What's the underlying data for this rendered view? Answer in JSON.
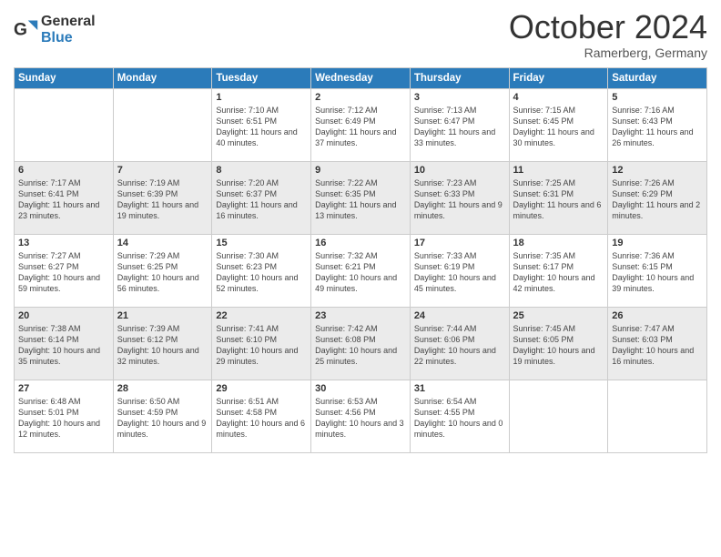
{
  "header": {
    "logo_line1": "General",
    "logo_line2": "Blue",
    "month": "October 2024",
    "location": "Ramerberg, Germany"
  },
  "days_of_week": [
    "Sunday",
    "Monday",
    "Tuesday",
    "Wednesday",
    "Thursday",
    "Friday",
    "Saturday"
  ],
  "rows": [
    [
      {
        "day": "",
        "sunrise": "",
        "sunset": "",
        "daylight": ""
      },
      {
        "day": "",
        "sunrise": "",
        "sunset": "",
        "daylight": ""
      },
      {
        "day": "1",
        "sunrise": "Sunrise: 7:10 AM",
        "sunset": "Sunset: 6:51 PM",
        "daylight": "Daylight: 11 hours and 40 minutes."
      },
      {
        "day": "2",
        "sunrise": "Sunrise: 7:12 AM",
        "sunset": "Sunset: 6:49 PM",
        "daylight": "Daylight: 11 hours and 37 minutes."
      },
      {
        "day": "3",
        "sunrise": "Sunrise: 7:13 AM",
        "sunset": "Sunset: 6:47 PM",
        "daylight": "Daylight: 11 hours and 33 minutes."
      },
      {
        "day": "4",
        "sunrise": "Sunrise: 7:15 AM",
        "sunset": "Sunset: 6:45 PM",
        "daylight": "Daylight: 11 hours and 30 minutes."
      },
      {
        "day": "5",
        "sunrise": "Sunrise: 7:16 AM",
        "sunset": "Sunset: 6:43 PM",
        "daylight": "Daylight: 11 hours and 26 minutes."
      }
    ],
    [
      {
        "day": "6",
        "sunrise": "Sunrise: 7:17 AM",
        "sunset": "Sunset: 6:41 PM",
        "daylight": "Daylight: 11 hours and 23 minutes."
      },
      {
        "day": "7",
        "sunrise": "Sunrise: 7:19 AM",
        "sunset": "Sunset: 6:39 PM",
        "daylight": "Daylight: 11 hours and 19 minutes."
      },
      {
        "day": "8",
        "sunrise": "Sunrise: 7:20 AM",
        "sunset": "Sunset: 6:37 PM",
        "daylight": "Daylight: 11 hours and 16 minutes."
      },
      {
        "day": "9",
        "sunrise": "Sunrise: 7:22 AM",
        "sunset": "Sunset: 6:35 PM",
        "daylight": "Daylight: 11 hours and 13 minutes."
      },
      {
        "day": "10",
        "sunrise": "Sunrise: 7:23 AM",
        "sunset": "Sunset: 6:33 PM",
        "daylight": "Daylight: 11 hours and 9 minutes."
      },
      {
        "day": "11",
        "sunrise": "Sunrise: 7:25 AM",
        "sunset": "Sunset: 6:31 PM",
        "daylight": "Daylight: 11 hours and 6 minutes."
      },
      {
        "day": "12",
        "sunrise": "Sunrise: 7:26 AM",
        "sunset": "Sunset: 6:29 PM",
        "daylight": "Daylight: 11 hours and 2 minutes."
      }
    ],
    [
      {
        "day": "13",
        "sunrise": "Sunrise: 7:27 AM",
        "sunset": "Sunset: 6:27 PM",
        "daylight": "Daylight: 10 hours and 59 minutes."
      },
      {
        "day": "14",
        "sunrise": "Sunrise: 7:29 AM",
        "sunset": "Sunset: 6:25 PM",
        "daylight": "Daylight: 10 hours and 56 minutes."
      },
      {
        "day": "15",
        "sunrise": "Sunrise: 7:30 AM",
        "sunset": "Sunset: 6:23 PM",
        "daylight": "Daylight: 10 hours and 52 minutes."
      },
      {
        "day": "16",
        "sunrise": "Sunrise: 7:32 AM",
        "sunset": "Sunset: 6:21 PM",
        "daylight": "Daylight: 10 hours and 49 minutes."
      },
      {
        "day": "17",
        "sunrise": "Sunrise: 7:33 AM",
        "sunset": "Sunset: 6:19 PM",
        "daylight": "Daylight: 10 hours and 45 minutes."
      },
      {
        "day": "18",
        "sunrise": "Sunrise: 7:35 AM",
        "sunset": "Sunset: 6:17 PM",
        "daylight": "Daylight: 10 hours and 42 minutes."
      },
      {
        "day": "19",
        "sunrise": "Sunrise: 7:36 AM",
        "sunset": "Sunset: 6:15 PM",
        "daylight": "Daylight: 10 hours and 39 minutes."
      }
    ],
    [
      {
        "day": "20",
        "sunrise": "Sunrise: 7:38 AM",
        "sunset": "Sunset: 6:14 PM",
        "daylight": "Daylight: 10 hours and 35 minutes."
      },
      {
        "day": "21",
        "sunrise": "Sunrise: 7:39 AM",
        "sunset": "Sunset: 6:12 PM",
        "daylight": "Daylight: 10 hours and 32 minutes."
      },
      {
        "day": "22",
        "sunrise": "Sunrise: 7:41 AM",
        "sunset": "Sunset: 6:10 PM",
        "daylight": "Daylight: 10 hours and 29 minutes."
      },
      {
        "day": "23",
        "sunrise": "Sunrise: 7:42 AM",
        "sunset": "Sunset: 6:08 PM",
        "daylight": "Daylight: 10 hours and 25 minutes."
      },
      {
        "day": "24",
        "sunrise": "Sunrise: 7:44 AM",
        "sunset": "Sunset: 6:06 PM",
        "daylight": "Daylight: 10 hours and 22 minutes."
      },
      {
        "day": "25",
        "sunrise": "Sunrise: 7:45 AM",
        "sunset": "Sunset: 6:05 PM",
        "daylight": "Daylight: 10 hours and 19 minutes."
      },
      {
        "day": "26",
        "sunrise": "Sunrise: 7:47 AM",
        "sunset": "Sunset: 6:03 PM",
        "daylight": "Daylight: 10 hours and 16 minutes."
      }
    ],
    [
      {
        "day": "27",
        "sunrise": "Sunrise: 6:48 AM",
        "sunset": "Sunset: 5:01 PM",
        "daylight": "Daylight: 10 hours and 12 minutes."
      },
      {
        "day": "28",
        "sunrise": "Sunrise: 6:50 AM",
        "sunset": "Sunset: 4:59 PM",
        "daylight": "Daylight: 10 hours and 9 minutes."
      },
      {
        "day": "29",
        "sunrise": "Sunrise: 6:51 AM",
        "sunset": "Sunset: 4:58 PM",
        "daylight": "Daylight: 10 hours and 6 minutes."
      },
      {
        "day": "30",
        "sunrise": "Sunrise: 6:53 AM",
        "sunset": "Sunset: 4:56 PM",
        "daylight": "Daylight: 10 hours and 3 minutes."
      },
      {
        "day": "31",
        "sunrise": "Sunrise: 6:54 AM",
        "sunset": "Sunset: 4:55 PM",
        "daylight": "Daylight: 10 hours and 0 minutes."
      },
      {
        "day": "",
        "sunrise": "",
        "sunset": "",
        "daylight": ""
      },
      {
        "day": "",
        "sunrise": "",
        "sunset": "",
        "daylight": ""
      }
    ]
  ],
  "row_colors": [
    "odd",
    "even",
    "odd",
    "even",
    "odd"
  ]
}
